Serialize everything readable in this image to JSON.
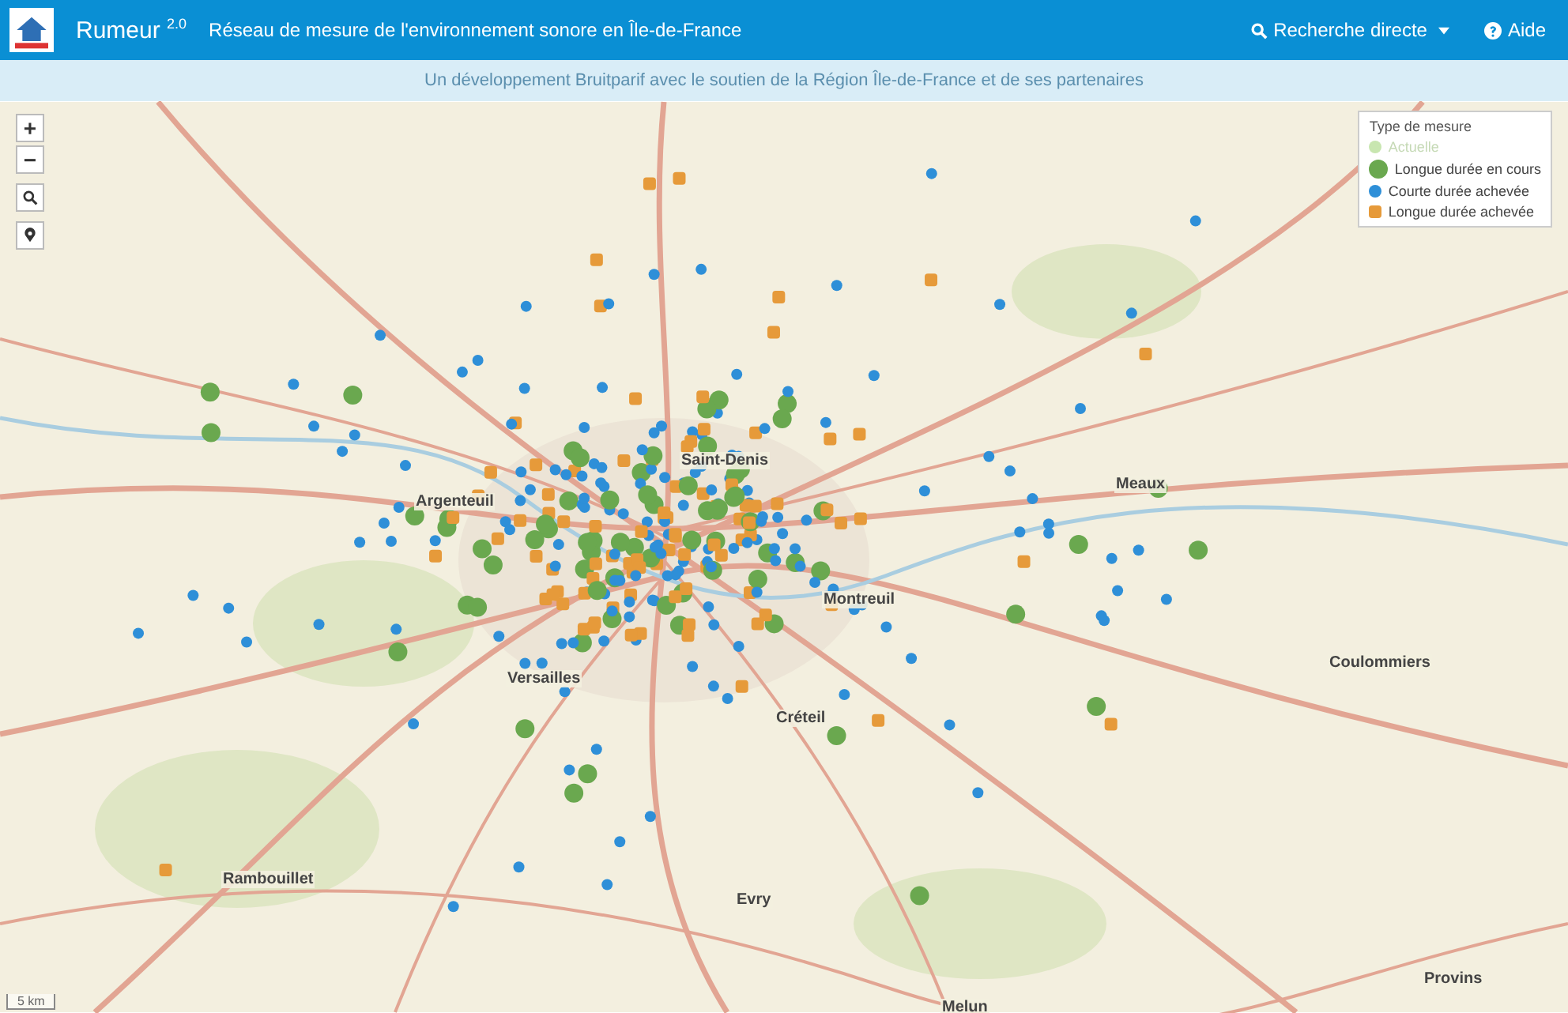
{
  "header": {
    "brand": "Rumeur",
    "version": "2.0",
    "subtitle": "Réseau de mesure de l'environnement sonore en Île-de-France",
    "search": "Recherche directe",
    "help": "Aide"
  },
  "banner": "Un développement Bruitparif avec le soutien de la Région Île-de-France et de ses partenaires",
  "map_controls": [
    "+",
    "−"
  ],
  "legend": {
    "title": "Type de mesure",
    "items": [
      {
        "label": "Actuelle",
        "color": "#c8e6b0",
        "disabled": true,
        "kind": "small"
      },
      {
        "label": "Longue durée en cours",
        "color": "#6aa84f",
        "disabled": false,
        "kind": "large"
      },
      {
        "label": "Courte durée achevée",
        "color": "#2e8fd8",
        "disabled": false,
        "kind": "small"
      },
      {
        "label": "Longue durée achevée",
        "color": "#e69a3a",
        "disabled": false,
        "kind": "square"
      }
    ]
  },
  "places": [
    "Argenteuil",
    "Saint-Denis",
    "Montreuil",
    "Versailles",
    "Créteil",
    "Evry",
    "Meaux",
    "Coulommiers",
    "Rambouillet",
    "Melun",
    "Provins"
  ],
  "scale": "5 km"
}
